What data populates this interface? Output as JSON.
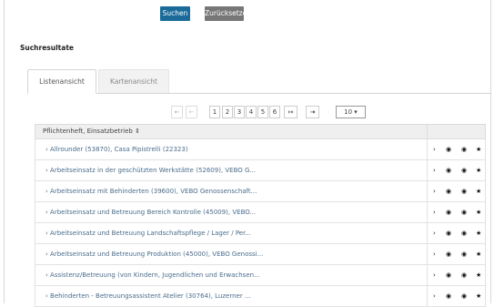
{
  "buttons": {
    "search": "Suchen",
    "reset": "Zurücksetzen"
  },
  "section_title": "Suchresultate",
  "tabs": [
    {
      "label": "Listenansicht"
    },
    {
      "label": "Kartenansicht"
    }
  ],
  "pager": {
    "first": "⇤",
    "prev": "⇠",
    "pages": [
      "1",
      "2",
      "3",
      "4",
      "5",
      "6"
    ],
    "next": "↦",
    "last": "⇥",
    "page_size": "10 ▾"
  },
  "table": {
    "header": "Pflichtenheft, Einsatzbetrieb ⇕",
    "rows": [
      "› Allrounder (53870), Casa Pipistrelli (22323)",
      "› Arbeitseinsatz in der geschützten Werkstätte (52609), VEBO G...",
      "› Arbeitseinsatz mit Behinderten (39600), VEBO Genossenschaft...",
      "› Arbeitseinsatz und Betreuung Bereich Kontrolle (45009), VEBO...",
      "› Arbeitseinsatz und Betreuung Landschaftspflege / Lager / Per...",
      "› Arbeitseinsatz und Betreuung Produktion (45000), VEBO Genossi...",
      "› Assistenz/Betreuung (von Kindern, Jugendlichen und Erwachsen...",
      "› Behinderten - Betreuungsassistent Atelier (30764), Luzerner ..."
    ],
    "actions": [
      "›",
      "◉",
      "◉",
      "★"
    ]
  }
}
